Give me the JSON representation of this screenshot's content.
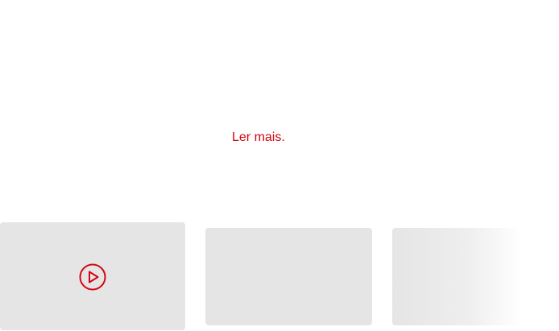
{
  "read_more": {
    "label": "Ler mais.",
    "color": "#d40511"
  },
  "carousel": {
    "cards": [
      {
        "has_play_icon": true,
        "icon": "play-circle-icon"
      },
      {
        "has_play_icon": false
      },
      {
        "has_play_icon": false,
        "faded": true
      }
    ],
    "placeholder_color": "#e5e5e5",
    "accent_color": "#d40511"
  }
}
